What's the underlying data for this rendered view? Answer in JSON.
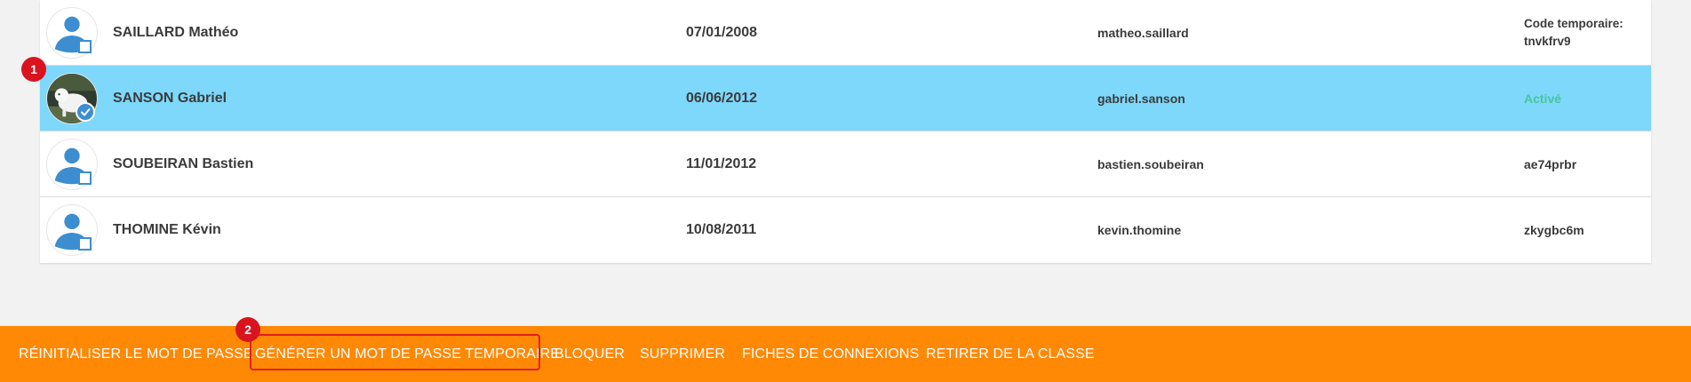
{
  "students": [
    {
      "name": "SAILLARD Mathéo",
      "birthdate": "07/01/2008",
      "login": "matheo.saillard",
      "password_line1": "Code temporaire:",
      "password_line2": "tnvkfrv9",
      "avatar": "default-user-icon",
      "selected": false
    },
    {
      "name": "SANSON Gabriel",
      "birthdate": "06/06/2012",
      "login": "gabriel.sanson",
      "password_status": "Activé",
      "avatar": "photo-avatar",
      "selected": true
    },
    {
      "name": "SOUBEIRAN Bastien",
      "birthdate": "11/01/2012",
      "login": "bastien.soubeiran",
      "password_status": "ae74prbr",
      "avatar": "default-user-icon",
      "selected": false
    },
    {
      "name": "THOMINE Kévin",
      "birthdate": "10/08/2011",
      "login": "kevin.thomine",
      "password_status": "zkygbc6m",
      "avatar": "default-user-icon",
      "selected": false
    }
  ],
  "annotations": {
    "badge1": "1",
    "badge2": "2"
  },
  "actions": {
    "reset_password": "RÉINITIALISER LE MOT DE PASSE",
    "generate_temp_password": "GÉNÉRER UN MOT DE PASSE TEMPORAIRE",
    "block": "BLOQUER",
    "delete": "SUPPRIMER",
    "connection_sheets": "FICHES DE CONNEXIONS",
    "remove_from_class": "RETIRER DE LA CLASSE"
  },
  "colors": {
    "selected_row": "#7dd8fb",
    "action_bar": "#ff8805",
    "badge": "#d9141e",
    "active_status": "#49c49a",
    "avatar_blue": "#3d8ed0"
  }
}
